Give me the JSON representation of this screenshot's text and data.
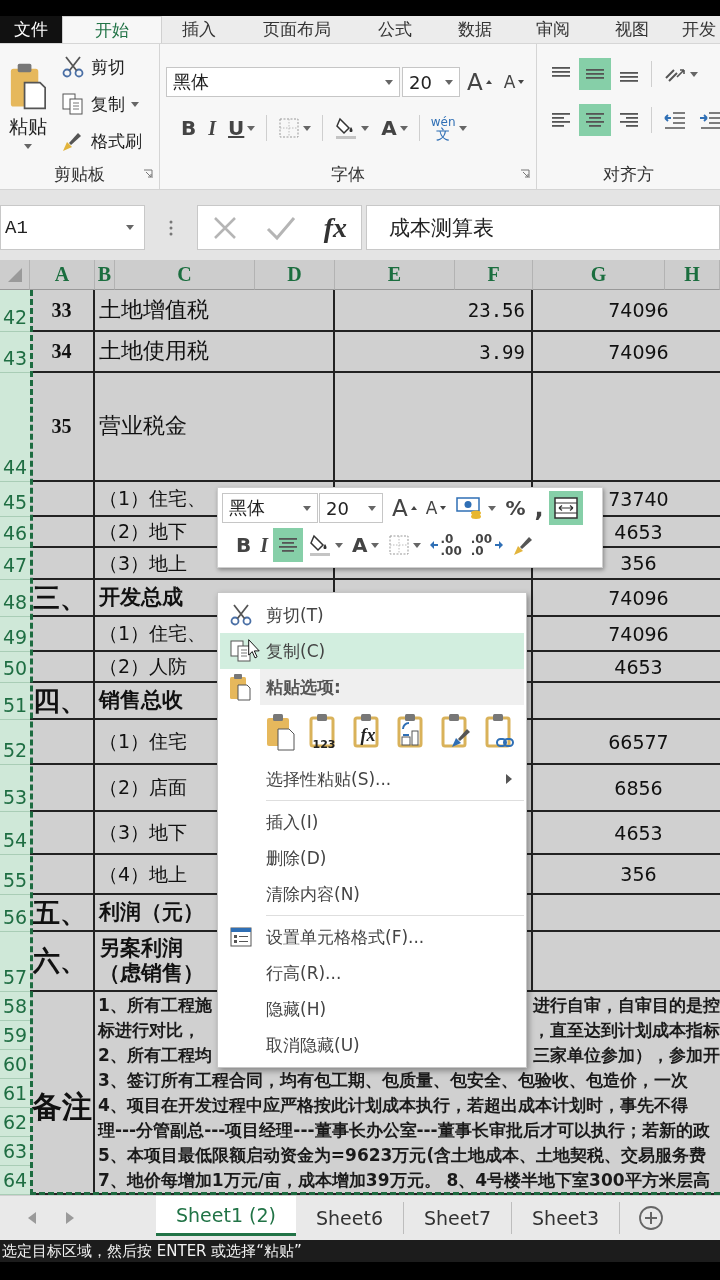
{
  "ribbon_tabs": [
    {
      "label": "文件",
      "kind": "file",
      "selected": false
    },
    {
      "label": "开始",
      "kind": "tab",
      "selected": true
    },
    {
      "label": "插入",
      "kind": "tab",
      "selected": false
    },
    {
      "label": "页面布局",
      "kind": "tab",
      "selected": false
    },
    {
      "label": "公式",
      "kind": "tab",
      "selected": false
    },
    {
      "label": "数据",
      "kind": "tab",
      "selected": false
    },
    {
      "label": "审阅",
      "kind": "tab",
      "selected": false
    },
    {
      "label": "视图",
      "kind": "tab",
      "selected": false
    },
    {
      "label": "开发",
      "kind": "tab",
      "selected": false
    }
  ],
  "ribbon": {
    "clipboard": {
      "paste": "粘贴",
      "paste_dropdown": true,
      "commands": [
        {
          "kind": "cut",
          "label": "剪切"
        },
        {
          "kind": "copy",
          "label": "复制",
          "dropdown": true
        },
        {
          "kind": "painter",
          "label": "格式刷"
        }
      ],
      "group_label": "剪贴板",
      "launcher": true
    },
    "font": {
      "font_name": "黑体",
      "font_size": "20",
      "row1": [
        {
          "kind": "grow",
          "text": "A",
          "selected": false
        },
        {
          "kind": "shrink",
          "text": "A",
          "selected": false
        }
      ],
      "row2": [
        {
          "kind": "bold",
          "text": "B",
          "selected": false
        },
        {
          "kind": "italic",
          "text": "I",
          "selected": false
        },
        {
          "kind": "underline",
          "text": "U",
          "selected": false,
          "dropdown": true
        },
        {
          "kind": "separator"
        },
        {
          "kind": "borders",
          "selected": false,
          "dropdown": true
        },
        {
          "kind": "separator"
        },
        {
          "kind": "fill",
          "selected": false,
          "dropdown": true
        },
        {
          "kind": "fontcolor",
          "text": "A",
          "selected": false,
          "dropdown": true
        },
        {
          "kind": "separator"
        },
        {
          "kind": "phonetic",
          "text": "wén",
          "subtext": "文",
          "selected": false,
          "dropdown": true
        }
      ],
      "group_label": "字体",
      "launcher": true
    },
    "alignment": {
      "row1": [
        {
          "kind": "align_top",
          "selected": false
        },
        {
          "kind": "align_middle",
          "selected": true
        },
        {
          "kind": "align_bottom",
          "selected": false
        },
        {
          "kind": "separator"
        },
        {
          "kind": "orientation",
          "selected": false,
          "dropdown": true
        }
      ],
      "row2": [
        {
          "kind": "align_left",
          "selected": false
        },
        {
          "kind": "align_center",
          "selected": true
        },
        {
          "kind": "align_right",
          "selected": false
        },
        {
          "kind": "separator"
        },
        {
          "kind": "indent_decrease",
          "selected": false
        },
        {
          "kind": "indent_increase",
          "selected": false
        }
      ],
      "group_label": "对齐方"
    }
  },
  "formula_bar": {
    "name_box": "A1",
    "function_label": "fx",
    "formula": "成本测算表"
  },
  "sheet": {
    "column_headers": [
      "A",
      "B",
      "C",
      "D",
      "E",
      "F",
      "G",
      "H"
    ],
    "rows": [
      {
        "row_header": "42",
        "kind": "item",
        "number": "33",
        "item": "土地增值税",
        "value_f": "23.56",
        "value_g": "74096"
      },
      {
        "row_header": "43",
        "kind": "item",
        "number": "34",
        "item": "土地使用税",
        "value_f": "3.99",
        "value_g": "74096"
      },
      {
        "row_header": "44",
        "kind": "item",
        "number": "35",
        "item": "营业税金"
      },
      {
        "row_header": "45",
        "kind": "sub",
        "item": "（1）住宅、",
        "value_g": "73740"
      },
      {
        "row_header": "46",
        "kind": "sub",
        "item": "（2）地下",
        "value_g": "4653"
      },
      {
        "row_header": "47",
        "kind": "sub",
        "item": "（3）地上",
        "value_g": "356"
      },
      {
        "row_header": "48",
        "kind": "section",
        "number": "三、",
        "item": "开发总成",
        "value_g": "74096"
      },
      {
        "row_header": "49",
        "kind": "sub",
        "item": "（1）住宅、",
        "value_g": "74096"
      },
      {
        "row_header": "50",
        "kind": "sub",
        "item": "（2）人防",
        "value_g": "4653"
      },
      {
        "row_header": "51",
        "kind": "section",
        "number": "四、",
        "item": "销售总收"
      },
      {
        "row_header": "52",
        "kind": "sub",
        "item": "（1）住宅",
        "value_g": "66577"
      },
      {
        "row_header": "53",
        "kind": "sub",
        "item": "（2）店面",
        "value_g": "6856"
      },
      {
        "row_header": "54",
        "kind": "sub",
        "item": "（3）地下",
        "value_g": "4653"
      },
      {
        "row_header": "55",
        "kind": "sub",
        "item": "（4）地上",
        "value_g": "356"
      },
      {
        "row_header": "56",
        "kind": "section",
        "number": "五、",
        "item": "利润（元）"
      },
      {
        "row_header": "57",
        "kind": "section",
        "number": "六、",
        "item": "另案利润（虑销售）"
      }
    ],
    "notes": {
      "row_headers": [
        "58",
        "59",
        "60",
        "61",
        "62",
        "63",
        "64"
      ],
      "label": "备注",
      "lines": [
        {
          "left": "1、所有工程施",
          "right": "进行自审，自审目的是控"
        },
        {
          "left": "标进行对比，",
          "right": "，直至达到计划成本指标"
        },
        {
          "left": "2、所有工程均",
          "right": "三家单位参加），参加开"
        },
        {
          "text": "3、签订所有工程合同，均有包工期、包质量、包安全、包验收、包造价，一次"
        },
        {
          "text": "4、项目在开发过程中应严格按此计划成本执行，若超出成本计划时，事先不得"
        },
        {
          "text": "理---分管副总---项目经理---董事长办公室---董事长审批后才可以执行；若新的政"
        },
        {
          "text": "5、本项目最低限额启动资金为=9623万元(含土地成本、土地契税、交易服务费"
        },
        {
          "text": "7、地价每增加1万元/亩，成本增加39万元。 8、4号楼半地下室300平方米层高"
        }
      ]
    }
  },
  "mini_toolbar": {
    "font_name": "黑体",
    "font_size": "20",
    "row1": [
      {
        "kind": "grow",
        "text": "A",
        "selected": false
      },
      {
        "kind": "shrink",
        "text": "A",
        "selected": false
      },
      {
        "kind": "accounting",
        "selected": false,
        "dropdown": true
      },
      {
        "kind": "percent",
        "text": "%",
        "selected": false
      },
      {
        "kind": "comma",
        "text": ",",
        "selected": false
      },
      {
        "kind": "merge",
        "selected": true
      }
    ],
    "row2": [
      {
        "kind": "bold",
        "text": "B",
        "selected": false
      },
      {
        "kind": "italic",
        "text": "I",
        "selected": false
      },
      {
        "kind": "align_center",
        "selected": true
      },
      {
        "kind": "fill",
        "selected": false,
        "dropdown": true
      },
      {
        "kind": "fontcolor",
        "text": "A",
        "selected": false,
        "dropdown": true
      },
      {
        "kind": "borders",
        "selected": false,
        "dropdown": true
      },
      {
        "kind": "inc_decimal",
        "text": ".0",
        "subtext": ".00",
        "selected": false
      },
      {
        "kind": "dec_decimal",
        "text": ".00",
        "subtext": ".0",
        "selected": false
      },
      {
        "kind": "painter",
        "selected": false
      }
    ]
  },
  "context_menu": {
    "items": [
      {
        "kind": "cut",
        "label": "剪切(T)",
        "selected": false
      },
      {
        "kind": "copy",
        "label": "复制(C)",
        "selected": true
      },
      {
        "kind": "paste_header",
        "label": "粘贴选项:"
      },
      {
        "kind": "paste_options",
        "options": [
          {
            "kind": "paste"
          },
          {
            "kind": "values",
            "caption": "123"
          },
          {
            "kind": "formulas",
            "caption": "fx"
          },
          {
            "kind": "transpose"
          },
          {
            "kind": "formatting"
          },
          {
            "kind": "link"
          }
        ]
      },
      {
        "kind": "submenu",
        "label": "选择性粘贴(S)...",
        "selected": false
      },
      {
        "kind": "separator"
      },
      {
        "kind": "command",
        "label": "插入(I)",
        "selected": false
      },
      {
        "kind": "command",
        "label": "删除(D)",
        "selected": false
      },
      {
        "kind": "command",
        "label": "清除内容(N)",
        "selected": false
      },
      {
        "kind": "separator"
      },
      {
        "kind": "format_cells",
        "label": "设置单元格格式(F)...",
        "selected": false
      },
      {
        "kind": "command",
        "label": "行高(R)...",
        "selected": false
      },
      {
        "kind": "command",
        "label": "隐藏(H)",
        "selected": false
      },
      {
        "kind": "command",
        "label": "取消隐藏(U)",
        "selected": false
      }
    ]
  },
  "sheet_tabs": [
    {
      "label": "Sheet1 (2)",
      "selected": true
    },
    {
      "label": "Sheet6",
      "selected": false
    },
    {
      "label": "Sheet7",
      "selected": false
    },
    {
      "label": "Sheet3",
      "selected": false
    }
  ],
  "status_bar": "选定目标区域，然后按 ENTER 或选择“粘贴”"
}
